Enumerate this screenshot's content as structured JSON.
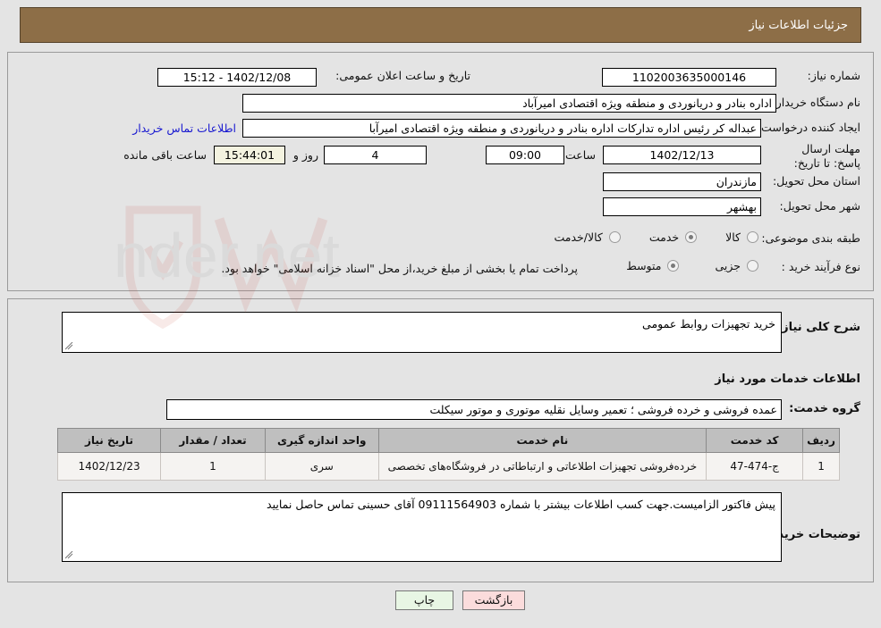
{
  "header": {
    "title": "جزئیات اطلاعات نیاز"
  },
  "colors": {
    "header_bg": "#8d6e47",
    "page_bg": "#e4e4e4",
    "link": "#1818d0",
    "table_header_bg": "#bfbfbf",
    "print_btn_bg": "#e8f6e4",
    "back_btn_bg": "#fbdcdc"
  },
  "form": {
    "need_number_label": "شماره نیاز:",
    "need_number_value": "1102003635000146",
    "announce_label": "تاریخ و ساعت اعلان عمومی:",
    "announce_value": "15:12 - 1402/12/08",
    "buyer_org_label": "نام دستگاه خریدار:",
    "buyer_org_value": "اداره بنادر و دریانوردی و منطقه ویژه اقتصادی امیرآباد",
    "creator_label": "ایجاد کننده درخواست:",
    "creator_value": "عبداله کر رئیس اداره تدارکات اداره بنادر و دریانوردی و منطقه ویژه اقتصادی امیرآبا",
    "contact_link": "اطلاعات تماس خریدار",
    "deadline_label": "مهلت ارسال پاسخ: تا تاریخ:",
    "deadline_date": "1402/12/13",
    "hour_label": "ساعت",
    "deadline_time": "09:00",
    "days_remaining": "4",
    "days_word": "روز و",
    "time_remaining": "15:44:01",
    "remaining_suffix": "ساعت باقی مانده",
    "province_label": "استان محل تحویل:",
    "province_value": "مازندران",
    "city_label": "شهر محل تحویل:",
    "city_value": "بهشهر",
    "category_label": "طبقه بندی موضوعی:",
    "category_options": [
      {
        "label": "کالا",
        "selected": false
      },
      {
        "label": "خدمت",
        "selected": true
      },
      {
        "label": "کالا/خدمت",
        "selected": false
      }
    ],
    "process_label": "نوع فرآیند خرید :",
    "process_options": [
      {
        "label": "جزیی",
        "selected": false
      },
      {
        "label": "متوسط",
        "selected": true
      }
    ],
    "payment_note": "پرداخت تمام یا بخشی از مبلغ خرید،از محل \"اسناد خزانه اسلامی\" خواهد بود."
  },
  "summary": {
    "label": "شرح کلی نیاز:",
    "value": "خرید تجهیزات روابط عمومی"
  },
  "services_section": {
    "title": "اطلاعات خدمات مورد نیاز",
    "group_label": "گروه خدمت:",
    "group_value": "عمده فروشی و خرده فروشی ؛ تعمیر وسایل نقلیه موتوری و موتور سیکلت"
  },
  "table": {
    "columns": [
      "ردیف",
      "کد خدمت",
      "نام خدمت",
      "واحد اندازه گیری",
      "تعداد / مقدار",
      "تاریخ نیاز"
    ],
    "rows": [
      {
        "row_no": "1",
        "service_code": "ج-474-47",
        "service_name": "خرده‌فروشی تجهیزات اطلاعاتی و ارتباطاتی در فروشگاه‌های تخصصی",
        "unit": "سری",
        "quantity": "1",
        "need_date": "1402/12/23"
      }
    ]
  },
  "buyer_notes": {
    "label": "توضیحات خریدار:",
    "value": "پیش فاکتور الزامیست.جهت کسب اطلاعات بیشتر با شماره 09111564903 آقای حسینی تماس حاصل نمایید"
  },
  "buttons": {
    "print": "چاپ",
    "back": "بازگشت"
  }
}
